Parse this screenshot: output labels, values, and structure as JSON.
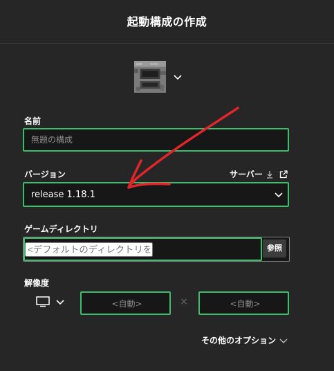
{
  "header": {
    "title": "起動構成の作成"
  },
  "icon_picker": {
    "icon": "furnace-block-icon"
  },
  "name_field": {
    "label": "名前",
    "placeholder": "無題の構成",
    "value": ""
  },
  "version_field": {
    "label": "バージョン",
    "server_link_label": "サーバー",
    "selected_value": "release 1.18.1"
  },
  "game_directory": {
    "label": "ゲームディレクトリ",
    "placeholder": "<デフォルトのディレクトリを使用する>",
    "value": "",
    "browse_label": "参照"
  },
  "resolution": {
    "label": "解像度",
    "width_placeholder": "<自動>",
    "height_placeholder": "<自動>",
    "separator": "×"
  },
  "more_options": {
    "label": "その他のオプション"
  },
  "colors": {
    "background": "#262626",
    "field_background": "#171717",
    "accent_green": "#3bbf6a",
    "annotation_arrow": "#e0262b"
  }
}
